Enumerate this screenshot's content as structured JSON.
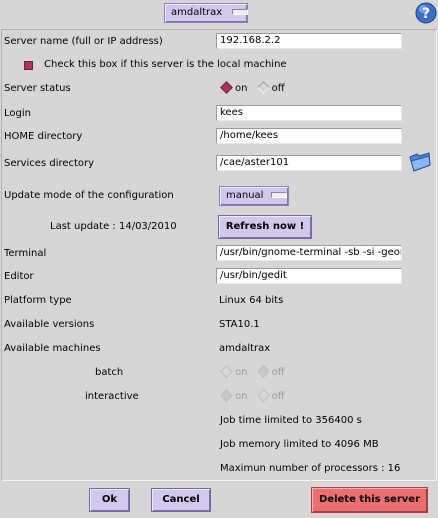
{
  "server_selector": {
    "value": "amdaltrax"
  },
  "server_name": {
    "label": "Server name (full or IP address)",
    "value": "192.168.2.2"
  },
  "local_checkbox": {
    "label": "Check this box if this server is the local machine"
  },
  "server_status": {
    "label": "Server status",
    "on": "on",
    "off": "off"
  },
  "login": {
    "label": "Login",
    "value": "kees"
  },
  "home_dir": {
    "label": "HOME directory",
    "value": "/home/kees"
  },
  "services_dir": {
    "label": "Services directory",
    "value": "/cae/aster101"
  },
  "update_mode": {
    "label": "Update mode of the configuration",
    "value": "manual"
  },
  "last_update": {
    "label": "Last update : 14/03/2010"
  },
  "refresh_button": {
    "label": "Refresh now !"
  },
  "terminal": {
    "label": "Terminal",
    "value": "/usr/bin/gnome-terminal -sb -si -geomet"
  },
  "editor": {
    "label": "Editor",
    "value": "/usr/bin/gedit"
  },
  "platform": {
    "label": "Platform type",
    "value": "Linux 64 bits"
  },
  "versions": {
    "label": "Available versions",
    "value": "STA10.1"
  },
  "machines": {
    "label": "Available machines",
    "value": "amdaltrax"
  },
  "batch": {
    "label": "batch",
    "on": "on",
    "off": "off"
  },
  "interactive": {
    "label": "interactive",
    "on": "on",
    "off": "off"
  },
  "limits": {
    "job_time": "Job time limited to 356400 s",
    "job_memory": "Job memory limited to 4096 MB",
    "max_processors": "Maximun number of processors : 16"
  },
  "footer": {
    "ok": "Ok",
    "cancel": "Cancel",
    "delete": "Delete this server"
  },
  "colors": {
    "accent": "#d2c8ee",
    "danger": "#ee6e6e",
    "selected": "#b03060"
  },
  "icons": {
    "help": "help-icon",
    "folder": "folder-icon"
  }
}
